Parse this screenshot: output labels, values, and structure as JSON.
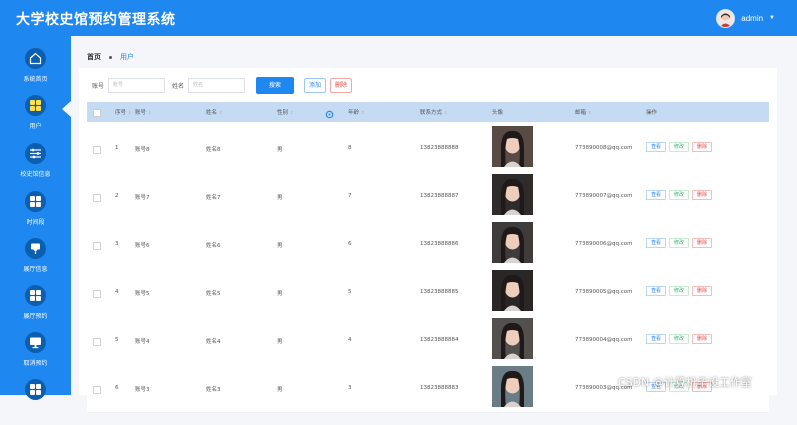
{
  "header": {
    "title": "大学校史馆预约管理系统",
    "username": "admin"
  },
  "sidebar": {
    "items": [
      {
        "label": "系统首页",
        "icon": "home-icon"
      },
      {
        "label": "用户",
        "icon": "grid-icon"
      },
      {
        "label": "校史馆信息",
        "icon": "sliders-icon"
      },
      {
        "label": "时间段",
        "icon": "grid-icon"
      },
      {
        "label": "展厅信息",
        "icon": "pin-icon"
      },
      {
        "label": "展厅预约",
        "icon": "grid-icon"
      },
      {
        "label": "取消预约",
        "icon": "monitor-icon"
      }
    ]
  },
  "breadcrumb": {
    "home": "首页",
    "current": "用户"
  },
  "search": {
    "account_label": "账号",
    "account_placeholder": "账号",
    "name_label": "姓名",
    "name_placeholder": "姓名",
    "search_button": "搜索",
    "add_button": "添加",
    "delete_button": "删除"
  },
  "table": {
    "columns": [
      "序号",
      "账号",
      "姓名",
      "性别",
      "年龄",
      "联系方式",
      "头像",
      "邮箱",
      "操作"
    ],
    "rows": [
      {
        "index": "1",
        "account": "账号8",
        "name": "姓名8",
        "gender": "男",
        "age": "8",
        "phone": "13823888888",
        "email": "773890008@qq.com"
      },
      {
        "index": "2",
        "account": "账号7",
        "name": "姓名7",
        "gender": "男",
        "age": "7",
        "phone": "13823888887",
        "email": "773890007@qq.com"
      },
      {
        "index": "3",
        "account": "账号6",
        "name": "姓名6",
        "gender": "男",
        "age": "6",
        "phone": "13823888886",
        "email": "773890006@qq.com"
      },
      {
        "index": "4",
        "account": "账号5",
        "name": "姓名5",
        "gender": "男",
        "age": "5",
        "phone": "13823888885",
        "email": "773890005@qq.com"
      },
      {
        "index": "5",
        "account": "账号4",
        "name": "姓名4",
        "gender": "男",
        "age": "4",
        "phone": "13823888884",
        "email": "773890004@qq.com"
      },
      {
        "index": "6",
        "account": "账号3",
        "name": "姓名3",
        "gender": "男",
        "age": "3",
        "phone": "13823888883",
        "email": "773890003@qq.com"
      }
    ],
    "actions": {
      "view": "查看",
      "edit": "修改",
      "delete": "删除"
    }
  },
  "watermark": "CSDN @计算机毕设工作室",
  "colors": {
    "primary": "#1e87f0",
    "header_row": "#c5dbf4",
    "danger": "#e54545",
    "success": "#27b56f"
  }
}
